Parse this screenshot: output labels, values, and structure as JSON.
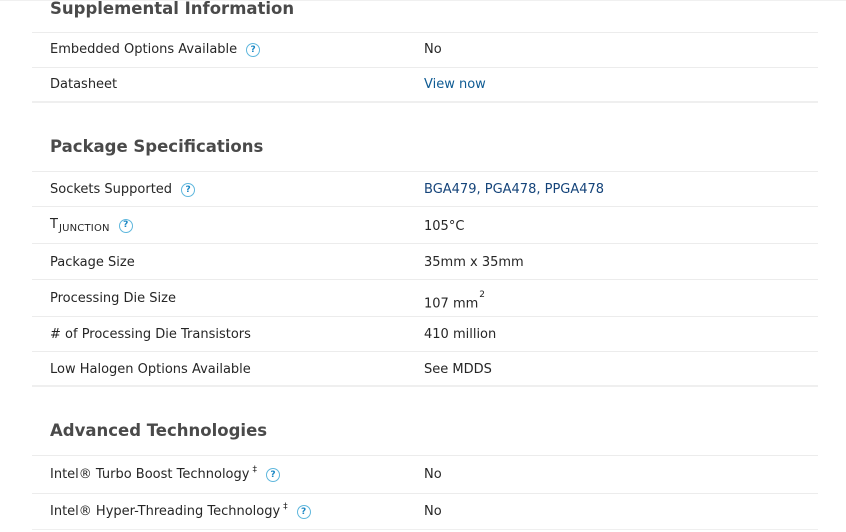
{
  "supplemental": {
    "title": "Supplemental Information",
    "embedded": {
      "label": "Embedded Options Available",
      "value": "No"
    },
    "datasheet": {
      "label": "Datasheet",
      "value": "View now"
    }
  },
  "package": {
    "title": "Package Specifications",
    "sockets": {
      "label": "Sockets Supported",
      "value": "BGA479, PGA478, PPGA478"
    },
    "tjunction": {
      "label_main": "T",
      "label_sub": "JUNCTION",
      "value": "105°C"
    },
    "package_size": {
      "label": "Package Size",
      "value": "35mm x 35mm"
    },
    "die_size": {
      "label": "Processing Die Size",
      "value": "107 mm",
      "value_exp": "2"
    },
    "transistors": {
      "label": "# of Processing Die Transistors",
      "value": "410 million"
    },
    "halogen": {
      "label": "Low Halogen Options Available",
      "value": "See MDDS"
    }
  },
  "advanced": {
    "title": "Advanced Technologies",
    "turbo": {
      "label": "Intel® Turbo Boost Technology",
      "mark": "‡",
      "value": "No"
    },
    "hyperthreading": {
      "label": "Intel® Hyper-Threading Technology",
      "mark": "‡",
      "value": "No"
    }
  },
  "help_glyph": "?",
  "icons": {
    "help": "question-circle-icon"
  },
  "colors": {
    "link": "#0f5b93",
    "help_icon": "#1b87c4",
    "title": "#4a4a4a"
  }
}
